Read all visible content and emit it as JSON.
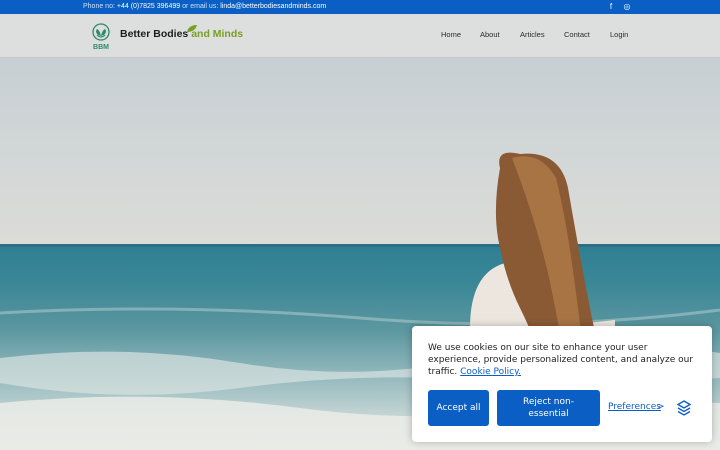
{
  "topbar": {
    "phone_label": "Phone no:",
    "phone": "+44 (0)7825 396499",
    "email_label": "or email us:",
    "email": "linda@betterbodiesandminds.com",
    "social": [
      {
        "icon": "facebook-icon",
        "glyph": "f"
      },
      {
        "icon": "instagram-icon",
        "glyph": "◎"
      }
    ]
  },
  "header": {
    "logo_text": "BBM",
    "brand_main": "Better Bodies",
    "brand_accent": "and Minds",
    "nav": [
      "Home",
      "About",
      "Articles",
      "Contact",
      "Login"
    ]
  },
  "cookie": {
    "message": "We use cookies on our site to enhance your user experience, provide personalized content, and analyze our traffic.",
    "policy_link": "Cookie Policy.",
    "accept_label": "Accept all",
    "reject_label": "Reject non-essential",
    "preferences_label": "Preferences",
    "preferences_chevron": ">"
  },
  "colors": {
    "primary": "#0b5fc4",
    "brand_green": "#7a9e27"
  }
}
